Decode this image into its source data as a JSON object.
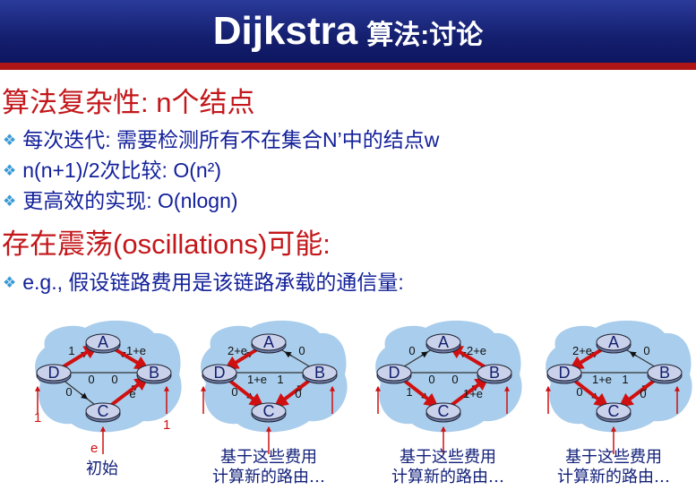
{
  "title": {
    "latin": "Dijkstra",
    "cjk": "算法:讨论"
  },
  "section1": {
    "heading": "算法复杂性: n个结点",
    "bullets": [
      "每次迭代: 需要检测所有不在集合N’中的结点w",
      "n(n+1)/2次比较: O(n²)",
      "更高效的实现: O(nlogn)"
    ]
  },
  "section2": {
    "heading": "存在震荡(oscillations)可能:",
    "bullets": [
      "e.g., 假设链路费用是该链路承载的通信量:"
    ]
  },
  "nodes": {
    "A": "A",
    "B": "B",
    "C": "C",
    "D": "D"
  },
  "panels": [
    {
      "caption": "初始",
      "weights": {
        "DA": "1",
        "AB": "1+e",
        "DC": "0",
        "CB": "e",
        "mid_left": "0",
        "mid_right": "0"
      },
      "inputs": {
        "D": "1",
        "B": "1",
        "C": "e"
      }
    },
    {
      "caption": "基于这些费用\n计算新的路由…",
      "weights": {
        "DA": "2+e",
        "AB": "0",
        "DC": "0",
        "CB": "0",
        "mid_left": "1+e",
        "mid_right": "1"
      }
    },
    {
      "caption": "基于这些费用\n计算新的路由…",
      "weights": {
        "DA": "0",
        "AB": "2+e",
        "DC": "1",
        "CB": "1+e",
        "mid_left": "0",
        "mid_right": "0"
      }
    },
    {
      "caption": "基于这些费用\n计算新的路由…",
      "weights": {
        "DA": "2+e",
        "AB": "0",
        "DC": "0",
        "CB": "0",
        "mid_left": "1+e",
        "mid_right": "1"
      }
    }
  ],
  "colors": {
    "title_bg": "#141f6e",
    "accent_red": "#c3171b",
    "text_blue": "#13209a",
    "bullet_mark": "#3a9ad6",
    "cloud": "#a9cdec"
  }
}
